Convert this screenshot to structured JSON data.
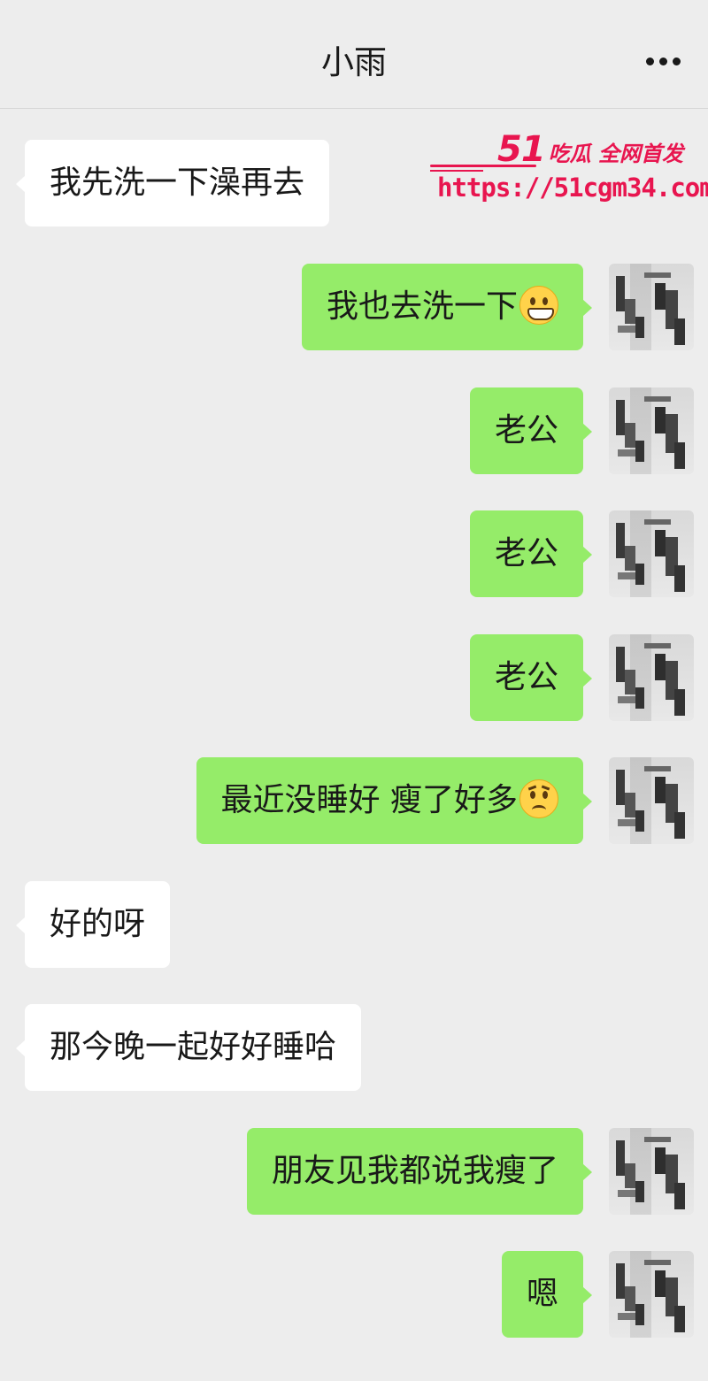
{
  "header": {
    "title": "小雨",
    "more_icon": "more-dots-icon"
  },
  "watermark": {
    "brand_num": "51",
    "brand_text": "吃瓜 全网首发",
    "url": "https://51cgm34.com",
    "color": "#e8154f"
  },
  "colors": {
    "background": "#ededed",
    "bubble_sent": "#95ec69",
    "bubble_received": "#ffffff"
  },
  "messages": [
    {
      "side": "left",
      "text": "我先洗一下澡再去"
    },
    {
      "side": "right",
      "text": "我也去洗一下",
      "emoji": "grinning-face-icon"
    },
    {
      "side": "right",
      "text": "老公"
    },
    {
      "side": "right",
      "text": "老公"
    },
    {
      "side": "right",
      "text": "老公"
    },
    {
      "side": "right",
      "text": "最近没睡好 瘦了好多",
      "emoji": "worried-face-icon"
    },
    {
      "side": "left",
      "text": "好的呀"
    },
    {
      "side": "left",
      "text": "那今晚一起好好睡哈"
    },
    {
      "side": "right",
      "text": "朋友见我都说我瘦了"
    },
    {
      "side": "right",
      "text": "嗯"
    }
  ]
}
